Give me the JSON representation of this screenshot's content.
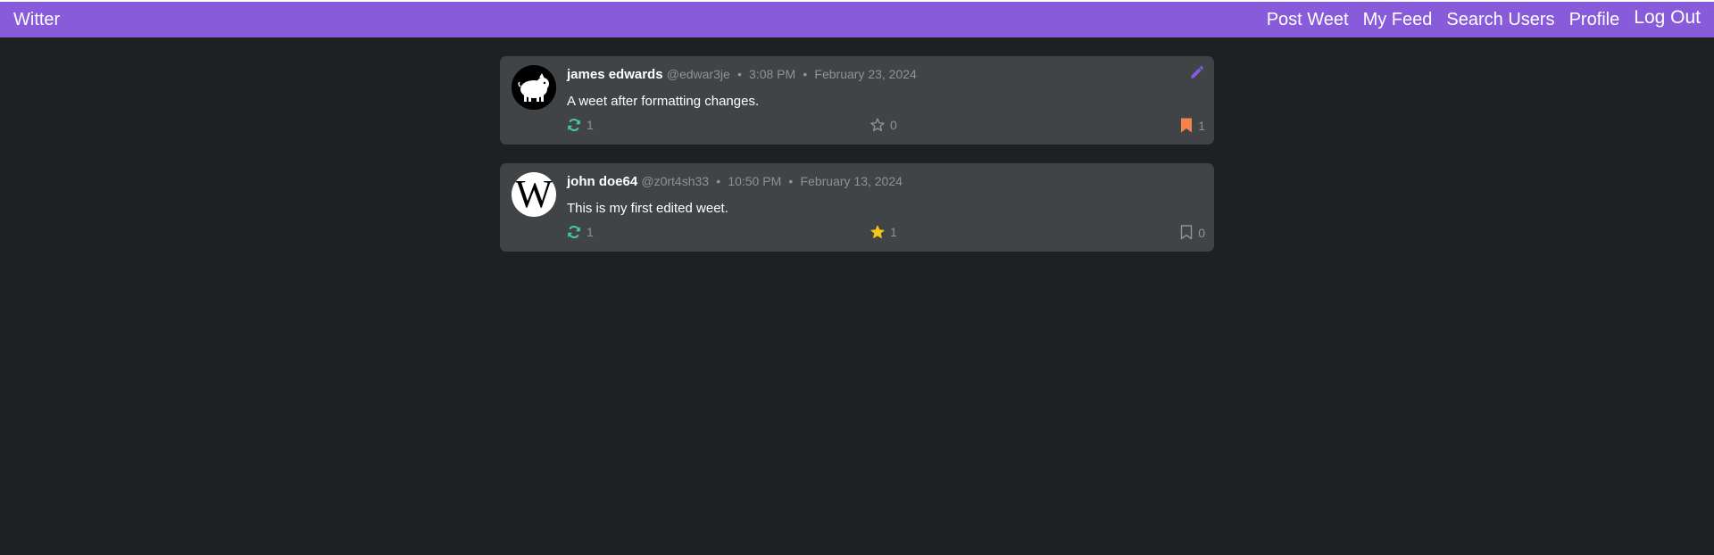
{
  "navbar": {
    "brand": "Witter",
    "links": {
      "post_weet": "Post Weet",
      "my_feed": "My Feed",
      "search_users": "Search Users",
      "profile": "Profile",
      "log_out": "Log Out"
    },
    "color": "#875bd9"
  },
  "colors": {
    "background": "#1e2022",
    "card": "#414447",
    "retweet": "#48c9a0",
    "star_active": "#f5c518",
    "bookmark_active": "#f5834a",
    "muted": "#8e9196",
    "edit": "#875bd9"
  },
  "weets": [
    {
      "author_name": "james edwards",
      "handle": "@edwar3je",
      "time": "3:08 PM",
      "date": "February 23, 2024",
      "text": "A weet after formatting changes.",
      "avatar_icon": "pig-avatar",
      "retweets": "1",
      "stars": "0",
      "starred": false,
      "bookmarks": "1",
      "bookmarked": true,
      "editable": true
    },
    {
      "author_name": "john doe64",
      "handle": "@z0rt4sh33",
      "time": "10:50 PM",
      "date": "February 13, 2024",
      "text": "This is my first edited weet.",
      "avatar_icon": "wikipedia-w-avatar",
      "avatar_letter": "W",
      "retweets": "1",
      "stars": "1",
      "starred": true,
      "bookmarks": "0",
      "bookmarked": false,
      "editable": false
    }
  ]
}
